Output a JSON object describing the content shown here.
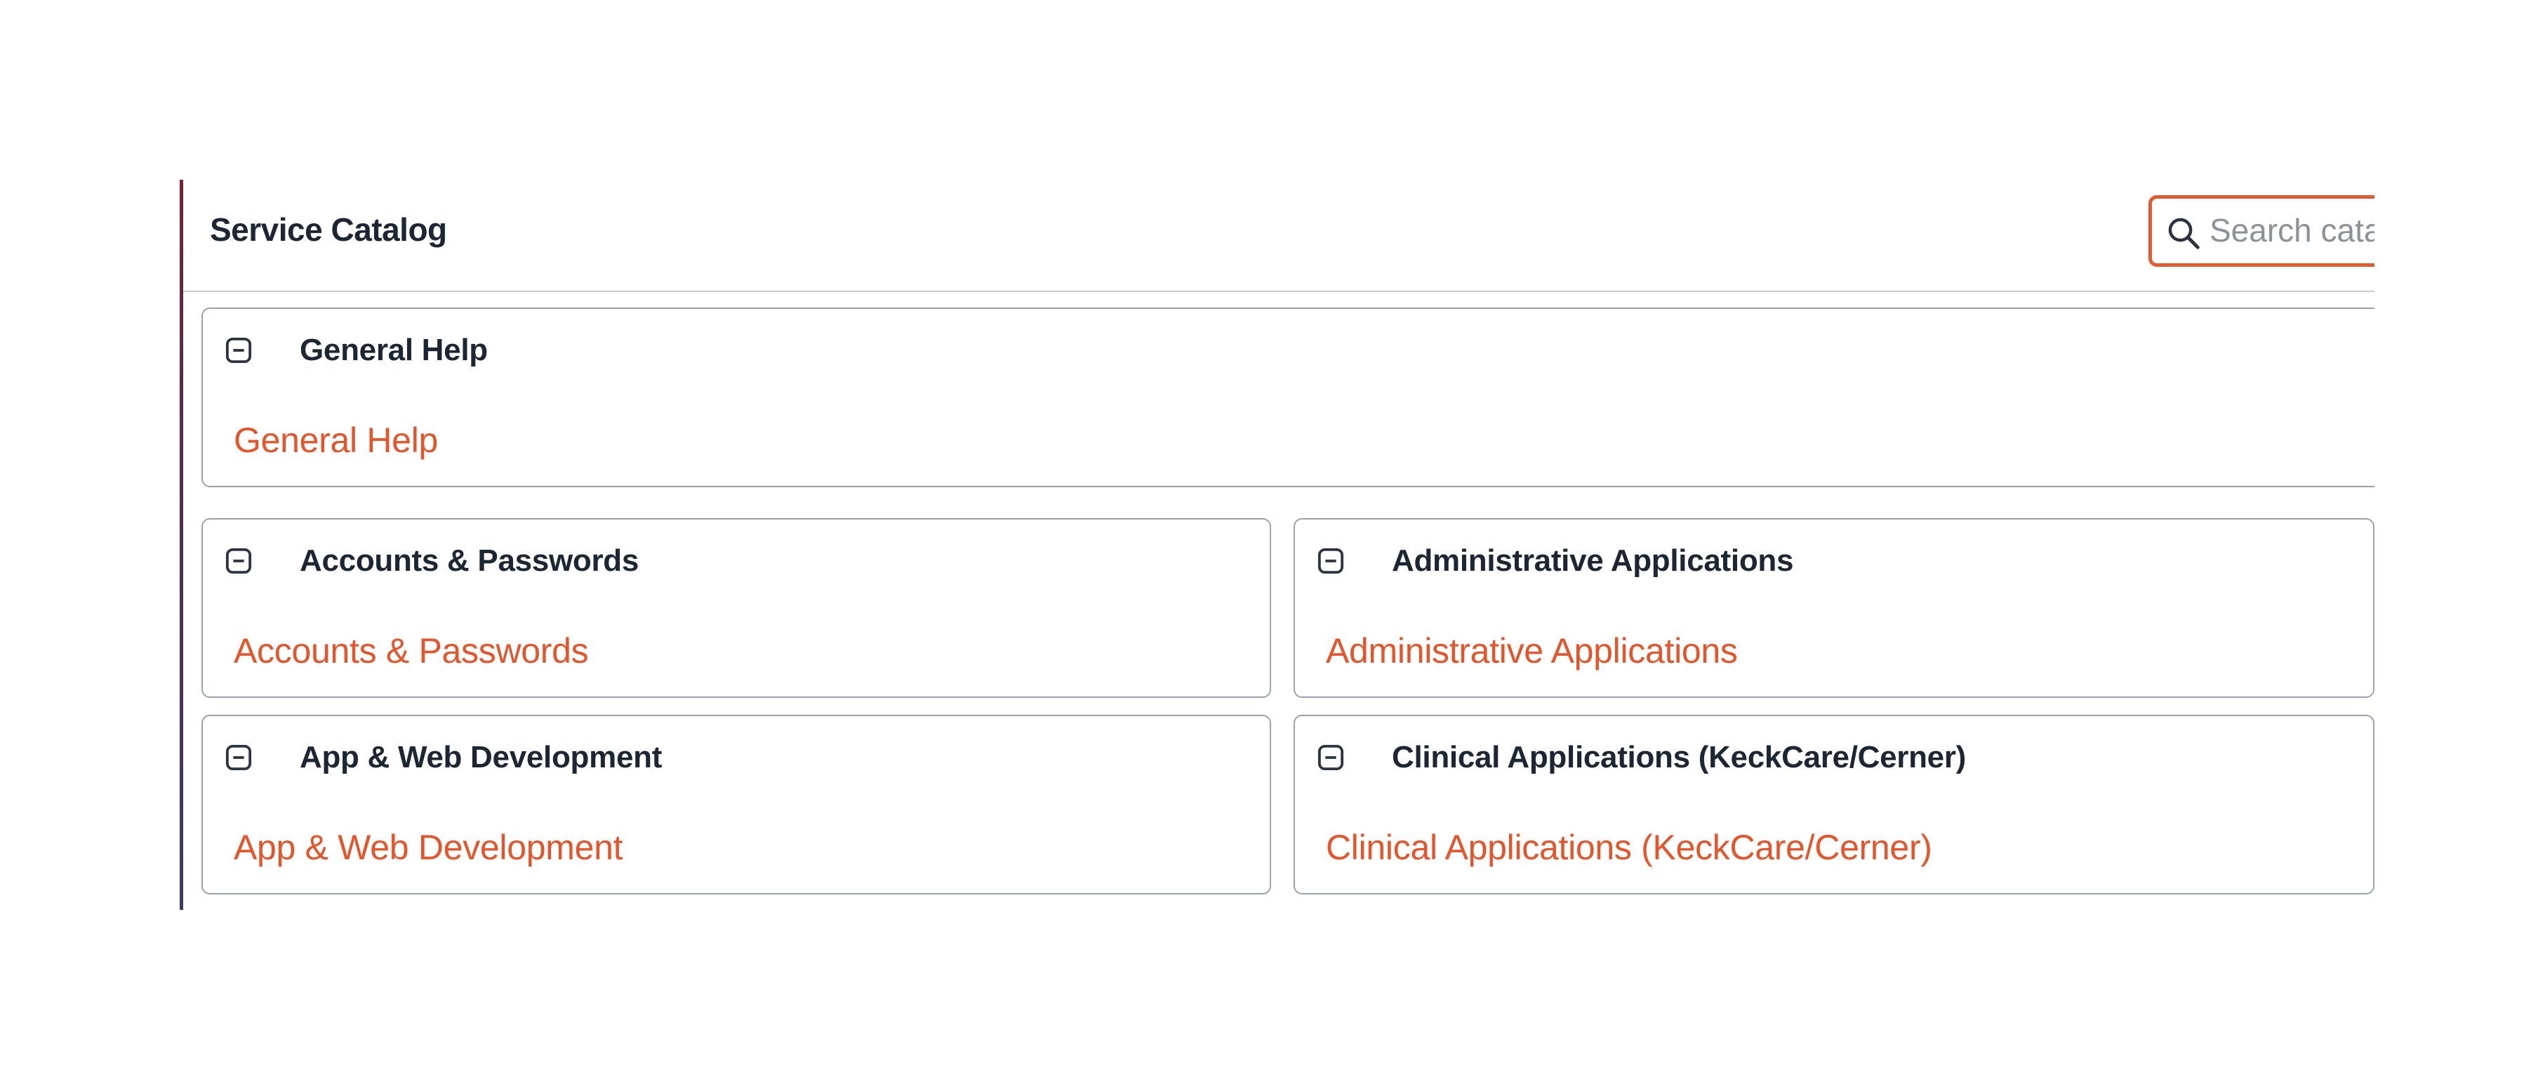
{
  "catalog": {
    "title": "Service Catalog",
    "search_placeholder": "Search catalog"
  },
  "sections": [
    {
      "title": "General Help",
      "link": "General Help"
    },
    {
      "title": "Accounts & Passwords",
      "link": "Accounts & Passwords"
    },
    {
      "title": "Administrative Applications",
      "link": "Administrative Applications"
    },
    {
      "title": "App & Web Development",
      "link": "App & Web Development"
    },
    {
      "title": "Clinical Applications (KeckCare/Cerner)",
      "link": "Clinical Applications (KeckCare/Cerner)"
    }
  ],
  "colors": {
    "accent": "#e8542a",
    "search_border": "#e45a30",
    "title_text": "#1d2733",
    "card_border": "#9aa2ad"
  },
  "icons": {
    "search": "search-icon",
    "collapse": "collapse-minus-icon"
  }
}
